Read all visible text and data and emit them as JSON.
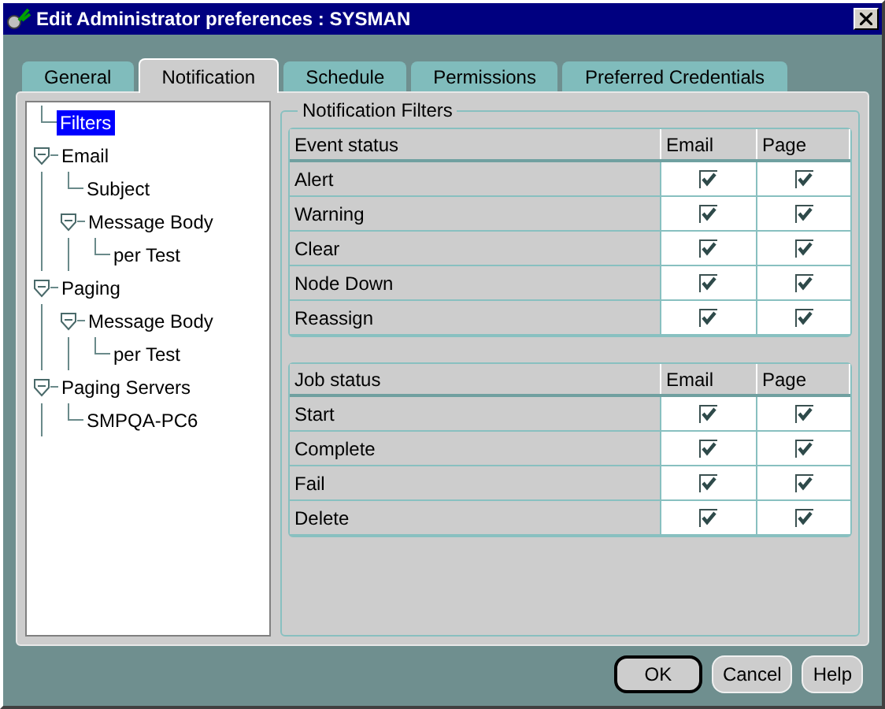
{
  "window": {
    "title": "Edit Administrator preferences : SYSMAN"
  },
  "tabs": [
    {
      "label": "General",
      "selected": false
    },
    {
      "label": "Notification",
      "selected": true
    },
    {
      "label": "Schedule",
      "selected": false
    },
    {
      "label": "Permissions",
      "selected": false
    },
    {
      "label": "Preferred Credentials",
      "selected": false
    }
  ],
  "tree": [
    {
      "label": "Filters",
      "selected": true
    },
    {
      "label": "Email",
      "selected": false,
      "expanded": true,
      "children": [
        {
          "label": "Subject",
          "selected": false
        },
        {
          "label": "Message Body",
          "selected": false,
          "expanded": true,
          "children": [
            {
              "label": "per Test",
              "selected": false
            }
          ]
        }
      ]
    },
    {
      "label": "Paging",
      "selected": false,
      "expanded": true,
      "children": [
        {
          "label": "Message Body",
          "selected": false,
          "expanded": true,
          "children": [
            {
              "label": "per Test",
              "selected": false
            }
          ]
        }
      ]
    },
    {
      "label": "Paging Servers",
      "selected": false,
      "expanded": true,
      "children": [
        {
          "label": "SMPQA-PC6",
          "selected": false
        }
      ]
    }
  ],
  "filters": {
    "title": "Notification Filters",
    "tables": [
      {
        "columns": [
          "Event status",
          "Email",
          "Page"
        ],
        "rows": [
          {
            "label": "Alert",
            "email": true,
            "page": true
          },
          {
            "label": "Warning",
            "email": true,
            "page": true
          },
          {
            "label": "Clear",
            "email": true,
            "page": true
          },
          {
            "label": "Node Down",
            "email": true,
            "page": true
          },
          {
            "label": "Reassign",
            "email": true,
            "page": true
          }
        ]
      },
      {
        "columns": [
          "Job status",
          "Email",
          "Page"
        ],
        "rows": [
          {
            "label": "Start",
            "email": true,
            "page": true
          },
          {
            "label": "Complete",
            "email": true,
            "page": true
          },
          {
            "label": "Fail",
            "email": true,
            "page": true
          },
          {
            "label": "Delete",
            "email": true,
            "page": true
          }
        ]
      }
    ]
  },
  "buttons": [
    {
      "label": "OK",
      "default": true
    },
    {
      "label": "Cancel",
      "default": false
    },
    {
      "label": "Help",
      "default": false
    }
  ]
}
